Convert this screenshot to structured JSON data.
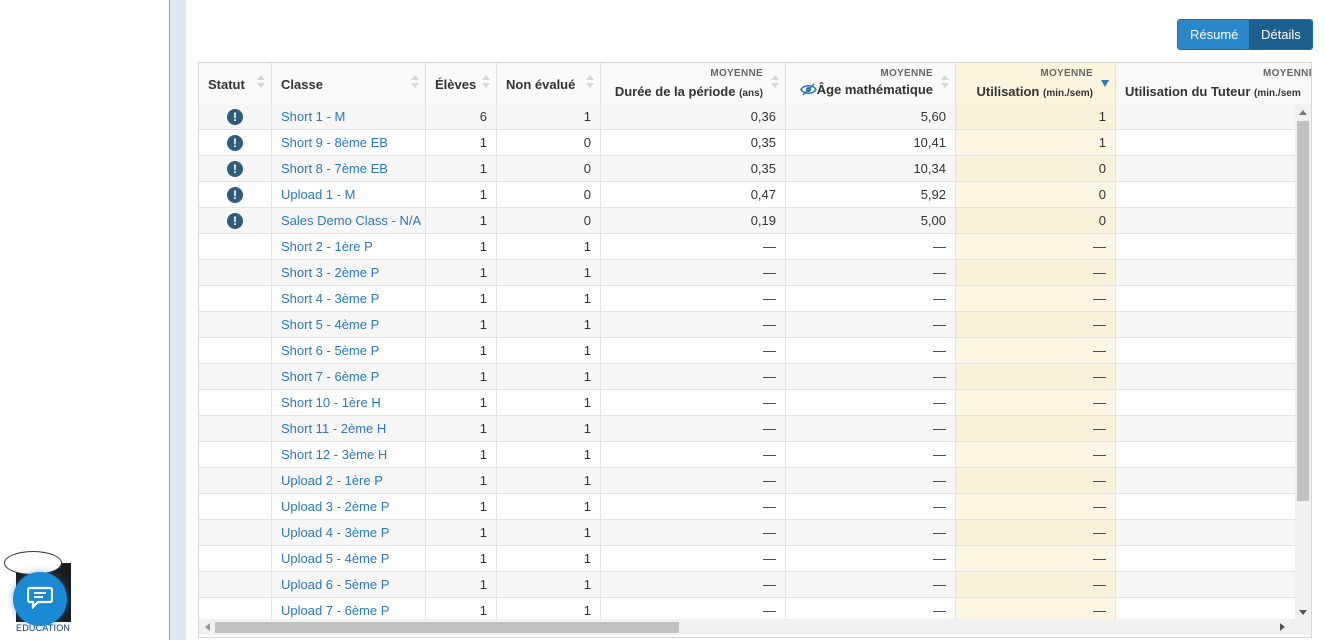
{
  "logo": {
    "text": "EDUCATION"
  },
  "view_toggle": {
    "resume": "Résumé",
    "details": "Détails"
  },
  "columns": {
    "statut": "Statut",
    "classe": "Classe",
    "eleves": "Élèves",
    "non_evalue": "Non évalué",
    "duree": {
      "super": "MOYENNE",
      "label": "Durée de la période",
      "unit": "(ans)"
    },
    "age": {
      "super": "MOYENNE",
      "label": "Âge mathématique"
    },
    "utilisation": {
      "super": "MOYENNE",
      "label": "Utilisation",
      "unit": "(min./sem)"
    },
    "tuteur": {
      "super": "MOYENNE",
      "label": "Utilisation du Tuteur",
      "unit": "(min./sem"
    }
  },
  "icons": {
    "status": "!",
    "age_column": "eye-icon",
    "chat": "chat-icon"
  },
  "colors": {
    "link": "#2a7ab8",
    "status_icon": "#2e5d80",
    "highlight": "#fcf7e2",
    "button_active": "#1e5f8e",
    "button": "#2a87c8"
  },
  "rows": [
    {
      "status": "!",
      "classe": "Short 1 - M",
      "eleves": "6",
      "non_evalue": "1",
      "duree": "0,36",
      "age": "5,60",
      "utilisation": "1",
      "tuteur": ""
    },
    {
      "status": "!",
      "classe": "Short 9 - 8ème EB",
      "eleves": "1",
      "non_evalue": "0",
      "duree": "0,35",
      "age": "10,41",
      "utilisation": "1",
      "tuteur": ""
    },
    {
      "status": "!",
      "classe": "Short 8 - 7ème EB",
      "eleves": "1",
      "non_evalue": "0",
      "duree": "0,35",
      "age": "10,34",
      "utilisation": "0",
      "tuteur": ""
    },
    {
      "status": "!",
      "classe": "Upload 1 - M",
      "eleves": "1",
      "non_evalue": "0",
      "duree": "0,47",
      "age": "5,92",
      "utilisation": "0",
      "tuteur": ""
    },
    {
      "status": "!",
      "classe": "Sales Demo Class - N/A",
      "eleves": "1",
      "non_evalue": "0",
      "duree": "0,19",
      "age": "5,00",
      "utilisation": "0",
      "tuteur": ""
    },
    {
      "status": "",
      "classe": "Short 2 - 1ère P",
      "eleves": "1",
      "non_evalue": "1",
      "duree": "—",
      "age": "—",
      "utilisation": "—",
      "tuteur": ""
    },
    {
      "status": "",
      "classe": "Short 3 - 2ème P",
      "eleves": "1",
      "non_evalue": "1",
      "duree": "—",
      "age": "—",
      "utilisation": "—",
      "tuteur": ""
    },
    {
      "status": "",
      "classe": "Short 4 - 3ème P",
      "eleves": "1",
      "non_evalue": "1",
      "duree": "—",
      "age": "—",
      "utilisation": "—",
      "tuteur": ""
    },
    {
      "status": "",
      "classe": "Short 5 - 4ème P",
      "eleves": "1",
      "non_evalue": "1",
      "duree": "—",
      "age": "—",
      "utilisation": "—",
      "tuteur": ""
    },
    {
      "status": "",
      "classe": "Short 6 - 5ème P",
      "eleves": "1",
      "non_evalue": "1",
      "duree": "—",
      "age": "—",
      "utilisation": "—",
      "tuteur": ""
    },
    {
      "status": "",
      "classe": "Short 7 - 6ème P",
      "eleves": "1",
      "non_evalue": "1",
      "duree": "—",
      "age": "—",
      "utilisation": "—",
      "tuteur": ""
    },
    {
      "status": "",
      "classe": "Short 10 - 1ère H",
      "eleves": "1",
      "non_evalue": "1",
      "duree": "—",
      "age": "—",
      "utilisation": "—",
      "tuteur": ""
    },
    {
      "status": "",
      "classe": "Short 11 - 2ème H",
      "eleves": "1",
      "non_evalue": "1",
      "duree": "—",
      "age": "—",
      "utilisation": "—",
      "tuteur": ""
    },
    {
      "status": "",
      "classe": "Short 12 - 3ème H",
      "eleves": "1",
      "non_evalue": "1",
      "duree": "—",
      "age": "—",
      "utilisation": "—",
      "tuteur": ""
    },
    {
      "status": "",
      "classe": "Upload 2 - 1ère P",
      "eleves": "1",
      "non_evalue": "1",
      "duree": "—",
      "age": "—",
      "utilisation": "—",
      "tuteur": ""
    },
    {
      "status": "",
      "classe": "Upload 3 - 2ème P",
      "eleves": "1",
      "non_evalue": "1",
      "duree": "—",
      "age": "—",
      "utilisation": "—",
      "tuteur": ""
    },
    {
      "status": "",
      "classe": "Upload 4 - 3ème P",
      "eleves": "1",
      "non_evalue": "1",
      "duree": "—",
      "age": "—",
      "utilisation": "—",
      "tuteur": ""
    },
    {
      "status": "",
      "classe": "Upload 5 - 4ème P",
      "eleves": "1",
      "non_evalue": "1",
      "duree": "—",
      "age": "—",
      "utilisation": "—",
      "tuteur": ""
    },
    {
      "status": "",
      "classe": "Upload 6 - 5ème P",
      "eleves": "1",
      "non_evalue": "1",
      "duree": "—",
      "age": "—",
      "utilisation": "—",
      "tuteur": ""
    },
    {
      "status": "",
      "classe": "Upload 7 - 6ème P",
      "eleves": "1",
      "non_evalue": "1",
      "duree": "—",
      "age": "—",
      "utilisation": "—",
      "tuteur": ""
    }
  ]
}
